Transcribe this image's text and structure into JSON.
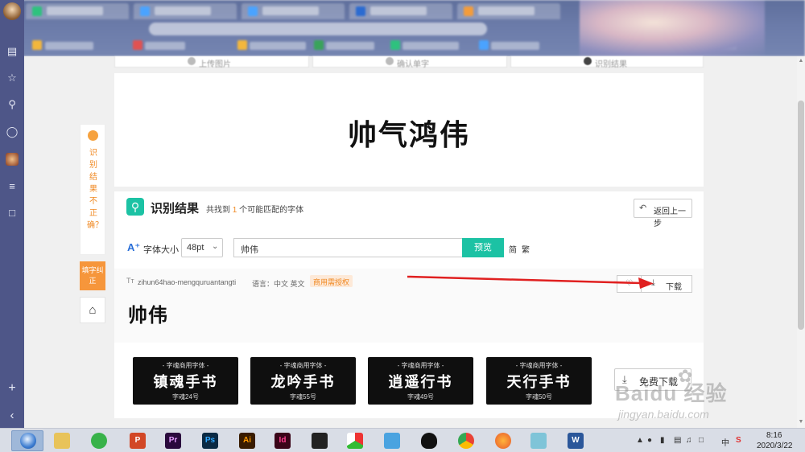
{
  "colors": {
    "accent": "#1cc2a4",
    "orange": "#f08a24",
    "sidebar": "#4e5688",
    "arrow": "#e02020"
  },
  "sidebar": {
    "icons": [
      "notes-icon",
      "star-icon",
      "search-icon",
      "chat-icon",
      "avatar-icon",
      "translate-icon",
      "book-icon",
      "plus-icon",
      "collapse-icon"
    ]
  },
  "steps": [
    {
      "label": "上传图片"
    },
    {
      "label": "确认单字"
    },
    {
      "label": "识别结果"
    }
  ],
  "preview": {
    "text": "帅气鸿伟"
  },
  "left_float": {
    "feedback_label": "识别结果不正确？",
    "fill_label": "填字纠正",
    "home_icon": "home-icon"
  },
  "result": {
    "title": "识别结果",
    "subtitle_prefix": "共找到",
    "count": "1",
    "subtitle_suffix": "个可能匹配的字体",
    "back_label": "返回上一步",
    "font_size_label": "字体大小",
    "font_size_value": "48pt",
    "text_input_value": "帅伟",
    "preview_button": "预览",
    "simplified": "简",
    "traditional": "繁"
  },
  "font_item": {
    "name": "zihun64hao-mengquruantangti",
    "language": "语言：中文 英文",
    "badge": "商用需授权",
    "sample": "帅伟",
    "download_label": "下载"
  },
  "recommended": {
    "items": [
      {
        "caption": "- 字魂商用字体 -",
        "name": "镇魂手书",
        "id": "字魂24号"
      },
      {
        "caption": "- 字魂商用字体 -",
        "name": "龙吟手书",
        "id": "字魂55号"
      },
      {
        "caption": "- 字魂商用字体 -",
        "name": "逍遥行书",
        "id": "字魂49号"
      },
      {
        "caption": "- 字魂商用字体 -",
        "name": "天行手书",
        "id": "字魂50号"
      }
    ],
    "free_download_label": "免费下载"
  },
  "watermark": {
    "main": "Baidu 经验",
    "url": "jingyan.baidu.com"
  },
  "taskbar": {
    "apps": [
      "start-orb-icon",
      "file-explorer-icon",
      "wechat-icon",
      "powerpoint-icon",
      "premiere-icon",
      "photoshop-icon",
      "illustrator-icon",
      "indesign-icon",
      "video-editor-icon",
      "screen-capture-icon",
      "bird-app-icon",
      "qq-icon",
      "chrome-icon",
      "firefox-icon",
      "tablet-app-icon",
      "word-icon"
    ],
    "time": "8:16",
    "date": "2020/3/22",
    "tray_label": "中"
  }
}
